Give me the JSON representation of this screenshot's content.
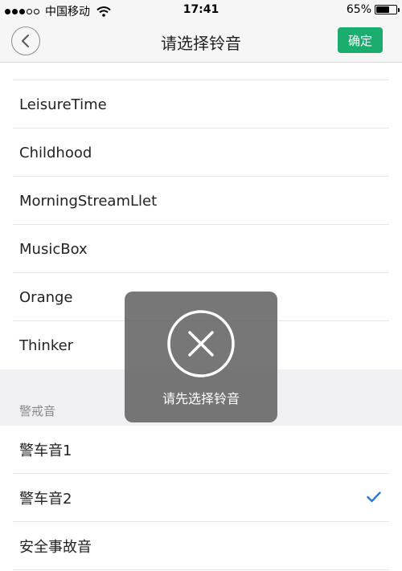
{
  "status_bar": {
    "carrier": "中国移动",
    "time": "17:41",
    "battery_percent": "65%",
    "battery_level": 0.65
  },
  "nav": {
    "title": "请选择铃音",
    "confirm_label": "确定",
    "accent_color": "#1aad6e"
  },
  "ringtones": {
    "items": [
      {
        "label": "LeisureTime"
      },
      {
        "label": "Childhood"
      },
      {
        "label": "MorningStreamLlet"
      },
      {
        "label": "MusicBox"
      },
      {
        "label": "Orange"
      },
      {
        "label": "Thinker"
      }
    ]
  },
  "alert_section": {
    "header": "警戒音",
    "items": [
      {
        "label": "警车音1",
        "selected": false
      },
      {
        "label": "警车音2",
        "selected": true
      },
      {
        "label": "安全事故音",
        "selected": false
      }
    ]
  },
  "toast": {
    "message": "请先选择铃音",
    "icon": "close-circle-icon"
  }
}
